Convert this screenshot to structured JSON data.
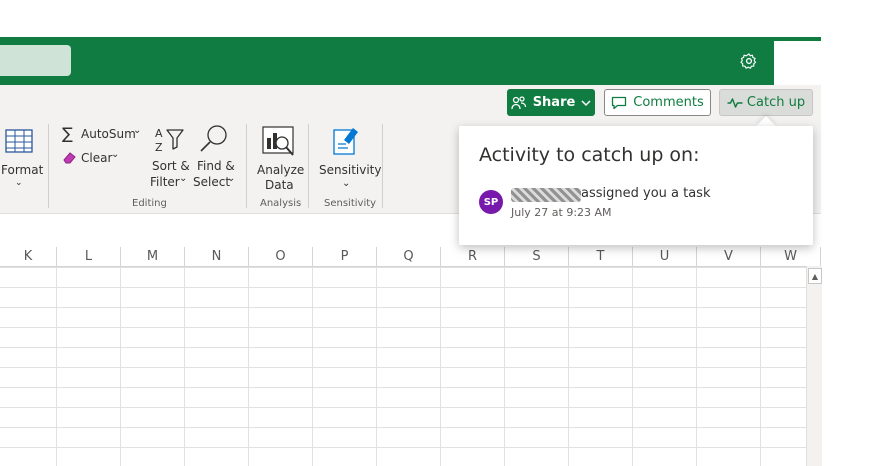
{
  "header": {
    "settings_icon": "gear-icon",
    "colors": {
      "brand": "#107c41",
      "avatar": "#7719aa"
    }
  },
  "actions": {
    "share_label": "Share",
    "comments_label": "Comments",
    "catchup_label": "Catch up"
  },
  "ribbon": {
    "format_label": "Format",
    "autosum_label": "AutoSum",
    "clear_label": "Clear",
    "sort_label_1": "Sort &",
    "sort_label_2": "Filter",
    "find_label_1": "Find &",
    "find_label_2": "Select",
    "analyze_label_1": "Analyze",
    "analyze_label_2": "Data",
    "sensitivity_label": "Sensitivity",
    "groups": {
      "editing": "Editing",
      "analysis": "Analysis",
      "sensitivity": "Sensitivity"
    }
  },
  "grid": {
    "columns": [
      "K",
      "L",
      "M",
      "N",
      "O",
      "P",
      "Q",
      "R",
      "S",
      "T",
      "U",
      "V",
      "W"
    ]
  },
  "popup": {
    "title": "Activity to catch up on:",
    "avatar_initials": "SP",
    "activity_text": "assigned you a task",
    "activity_time": "July 27 at 9:23 AM"
  }
}
